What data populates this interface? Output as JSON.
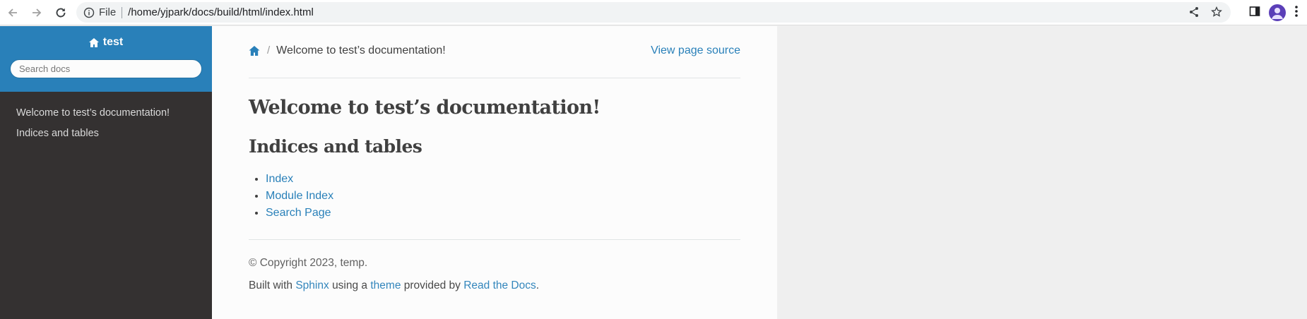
{
  "browser": {
    "file_label": "File",
    "url": "/home/yjpark/docs/build/html/index.html",
    "accent": "#5b3fb8"
  },
  "sidebar": {
    "project": "test",
    "search_placeholder": "Search docs",
    "items": [
      {
        "label": "Welcome to test’s documentation!"
      },
      {
        "label": "Indices and tables"
      }
    ],
    "colors": {
      "top": "#2980b9",
      "menu": "#343131"
    }
  },
  "breadcrumb": {
    "current": "Welcome to test’s documentation!",
    "view_source": "View page source"
  },
  "main": {
    "title": "Welcome to test’s documentation!",
    "section_title": "Indices and tables",
    "links": [
      {
        "label": "Index"
      },
      {
        "label": "Module Index"
      },
      {
        "label": "Search Page"
      }
    ]
  },
  "footer": {
    "copyright": "© Copyright 2023, temp.",
    "built_prefix": "Built with",
    "sphinx": "Sphinx",
    "using_a": "using a",
    "theme": "theme",
    "provided_by": "provided by",
    "rtd": "Read the Docs",
    "period": "."
  },
  "icons": [
    "back-icon",
    "forward-icon",
    "reload-icon",
    "info-icon",
    "share-icon",
    "star-icon",
    "side-panel-icon",
    "profile-avatar",
    "kebab-menu-icon",
    "home-icon"
  ]
}
